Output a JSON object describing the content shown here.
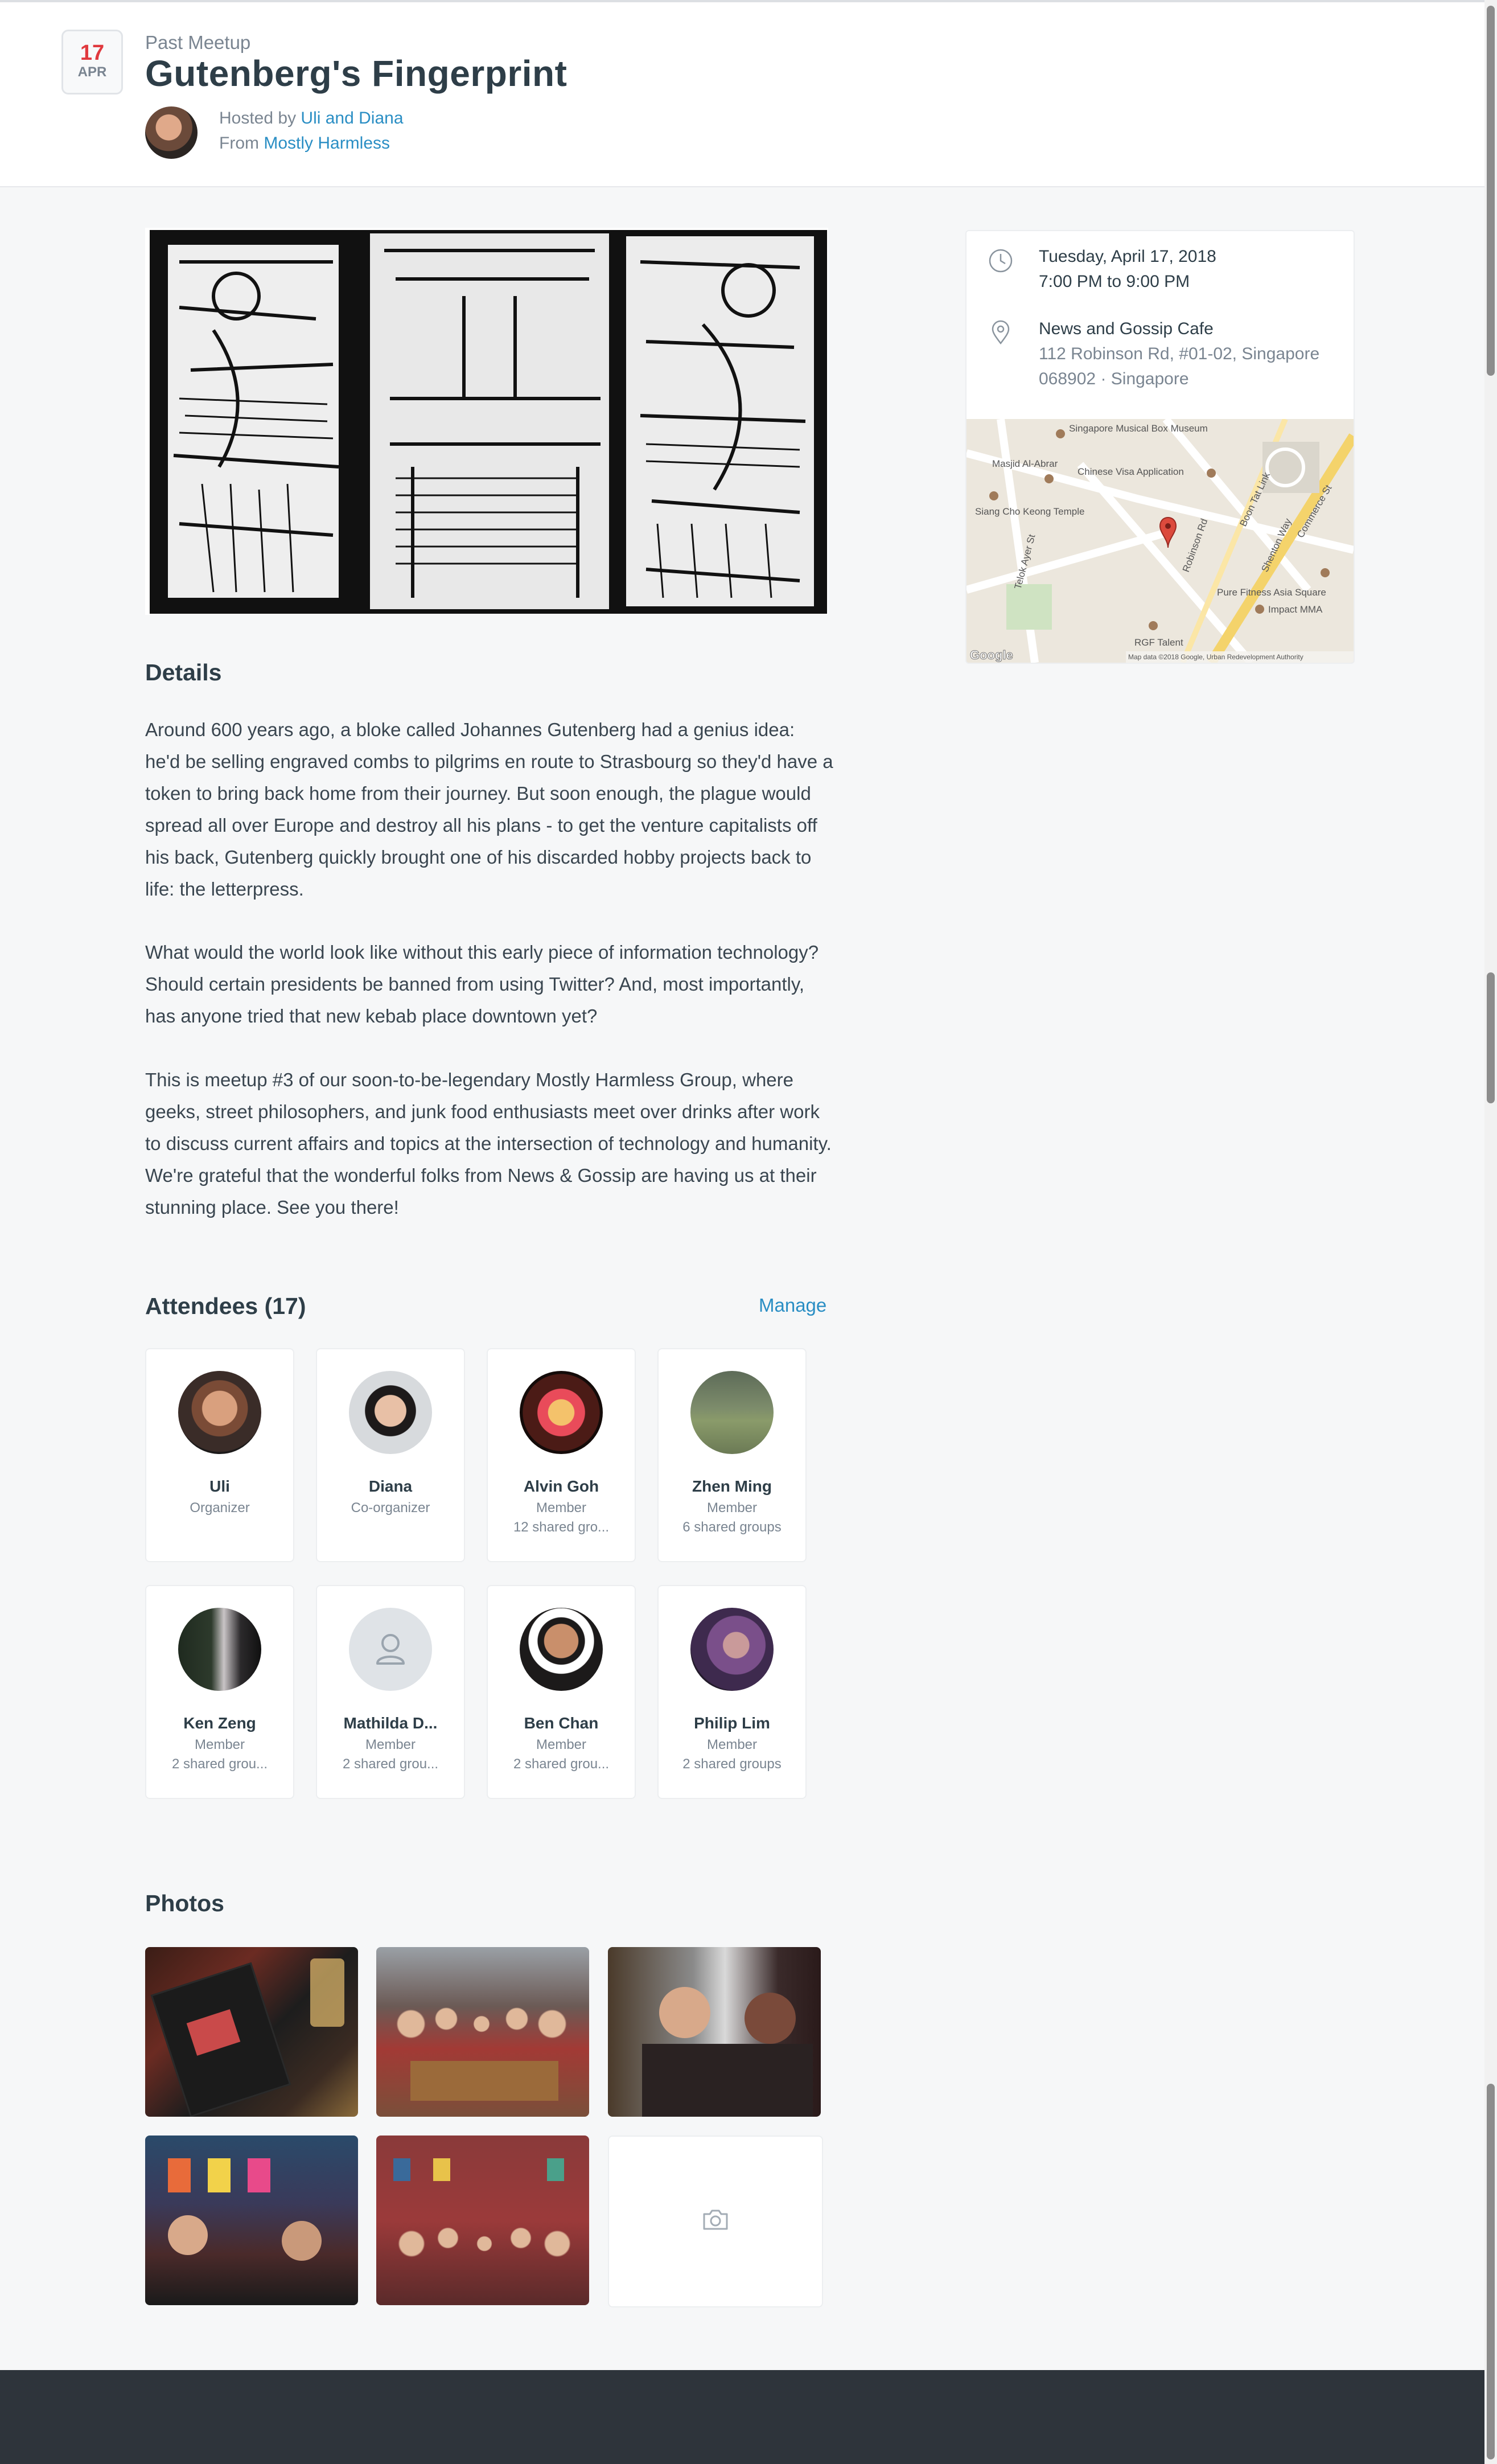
{
  "header": {
    "date_day": "17",
    "date_month": "APR",
    "kicker": "Past Meetup",
    "title": "Gutenberg's Fingerprint",
    "hosted_prefix": "Hosted by ",
    "hosts": "Uli and Diana",
    "from_prefix": "From ",
    "group": "Mostly Harmless"
  },
  "event": {
    "date": "Tuesday, April 17, 2018",
    "time": "7:00 PM to 9:00 PM",
    "venue": "News and Gossip Cafe",
    "address_line1": "112 Robinson Rd, #01-02, Singapore",
    "address_line2": "068902 · Singapore",
    "icons": {
      "time": "clock-icon",
      "location": "map-pin-icon"
    }
  },
  "map": {
    "labels": [
      "Singapore Musical Box Museum",
      "Masjid Al-Abrar",
      "Chinese Visa Application",
      "Siang Cho Keong Temple",
      "Telok Ayer St",
      "Robinson Rd",
      "Shenton Way",
      "Boon Tat Link",
      "Pure Fitness Asia Square",
      "Impact MMA",
      "RGF Talent",
      "Commerce St"
    ],
    "brand": "Google",
    "attribution": "Map data ©2018 Google, Urban Redevelopment Authority"
  },
  "details": {
    "heading": "Details",
    "paragraphs": [
      "Around 600 years ago, a bloke called Johannes Gutenberg had a genius idea: he'd be selling engraved combs to pilgrims en route to Strasbourg so they'd have a token to bring back home from their journey. But soon enough, the plague would spread all over Europe and destroy all his plans - to get the venture capitalists off his back, Gutenberg quickly brought one of his discarded hobby projects back to life: the letterpress.",
      "What would the world look like without this early piece of information technology? Should certain presidents be banned from using Twitter? And, most importantly, has anyone tried that new kebab place downtown yet?",
      "This is meetup #3 of our soon-to-be-legendary Mostly Harmless Group, where geeks, street philosophers, and junk food enthusiasts meet over drinks after work to discuss current affairs and topics at the intersection of technology and humanity. We're grateful that the wonderful folks from News & Gossip are having us at their stunning place. See you there!"
    ]
  },
  "attendees": {
    "heading": "Attendees (17)",
    "manage_label": "Manage",
    "list": [
      {
        "name": "Uli",
        "role": "Organizer",
        "shared": ""
      },
      {
        "name": "Diana",
        "role": "Co-organizer",
        "shared": ""
      },
      {
        "name": "Alvin Goh",
        "role": "Member",
        "shared": "12 shared gro..."
      },
      {
        "name": "Zhen Ming",
        "role": "Member",
        "shared": "6 shared groups"
      },
      {
        "name": "Ken Zeng",
        "role": "Member",
        "shared": "2 shared grou..."
      },
      {
        "name": "Mathilda D...",
        "role": "Member",
        "shared": "2 shared grou..."
      },
      {
        "name": "Ben Chan",
        "role": "Member",
        "shared": "2 shared grou..."
      },
      {
        "name": "Philip Lim",
        "role": "Member",
        "shared": "2 shared groups"
      }
    ]
  },
  "photos": {
    "heading": "Photos",
    "add_icon": "camera-icon"
  },
  "colors": {
    "accent_link": "#2a8ec4",
    "date_red": "#e0393e",
    "footer": "#2e343b"
  }
}
